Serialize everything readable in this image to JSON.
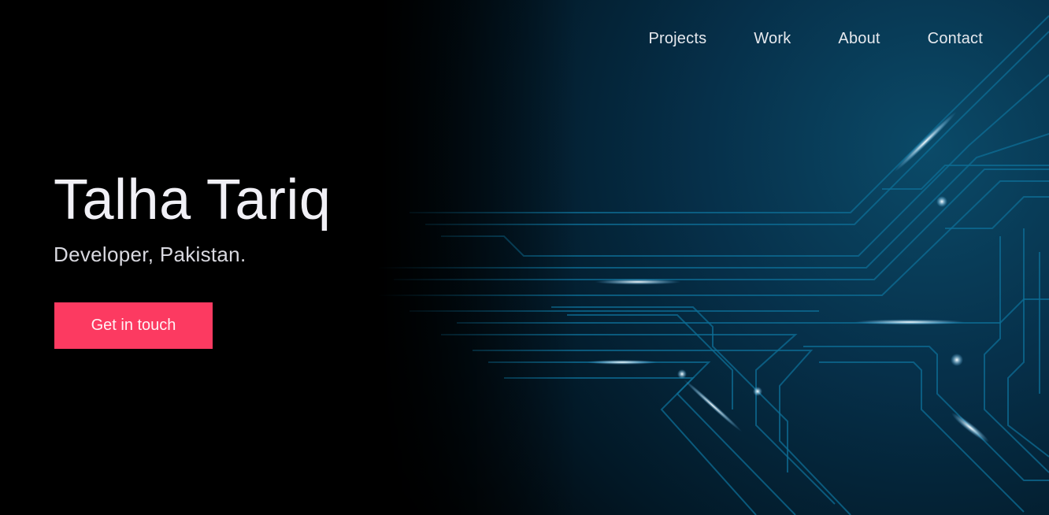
{
  "nav": {
    "items": [
      {
        "label": "Projects"
      },
      {
        "label": "Work"
      },
      {
        "label": "About"
      },
      {
        "label": "Contact"
      }
    ]
  },
  "hero": {
    "name": "Talha Tariq",
    "tagline": "Developer, Pakistan.",
    "cta_label": "Get in touch"
  },
  "colors": {
    "background": "#000000",
    "accent": "#fc3a61",
    "circuit": "#0e6d95",
    "glow": "#0a3a54"
  }
}
